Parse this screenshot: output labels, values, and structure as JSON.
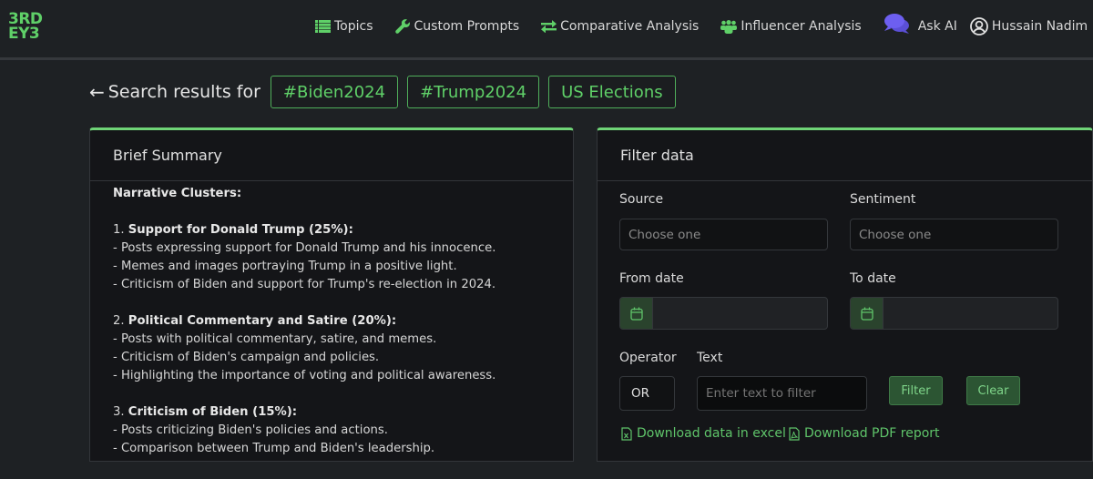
{
  "brand": {
    "logo_line1": "3RD",
    "logo_line2": "EY3",
    "accent": "#5fd068"
  },
  "nav": {
    "items": [
      {
        "label": "Topics",
        "icon": "list-icon"
      },
      {
        "label": "Custom Prompts",
        "icon": "wrench-icon"
      },
      {
        "label": "Comparative Analysis",
        "icon": "exchange-arrows-icon"
      },
      {
        "label": "Influencer Analysis",
        "icon": "users-group-icon"
      },
      {
        "label": "Ask AI",
        "icon": "chat-bubbles-icon"
      }
    ],
    "user": {
      "name": "Hussain Nadim",
      "icon": "user-circle-icon"
    }
  },
  "search": {
    "label": "Search results for",
    "tags": [
      "#Biden2024",
      "#Trump2024",
      "US Elections"
    ]
  },
  "summary": {
    "title": "Brief Summary",
    "heading": "Narrative Clusters:",
    "clusters": [
      {
        "number": "1.",
        "title": "Support for Donald Trump (25%):",
        "points": [
          "- Posts expressing support for Donald Trump and his innocence.",
          "- Memes and images portraying Trump in a positive light.",
          "- Criticism of Biden and support for Trump's re-election in 2024."
        ]
      },
      {
        "number": "2.",
        "title": "Political Commentary and Satire (20%):",
        "points": [
          "- Posts with political commentary, satire, and memes.",
          "- Criticism of Biden's campaign and policies.",
          "- Highlighting the importance of voting and political awareness."
        ]
      },
      {
        "number": "3.",
        "title": "Criticism of Biden (15%):",
        "points": [
          "- Posts criticizing Biden's policies and actions.",
          "- Comparison between Trump and Biden's leadership."
        ]
      }
    ]
  },
  "filter": {
    "title": "Filter data",
    "source": {
      "label": "Source",
      "placeholder": "Choose one"
    },
    "sentiment": {
      "label": "Sentiment",
      "placeholder": "Choose one"
    },
    "from_date": {
      "label": "From date",
      "value": ""
    },
    "to_date": {
      "label": "To date",
      "value": ""
    },
    "operator": {
      "label": "Operator",
      "value": "OR"
    },
    "text": {
      "label": "Text",
      "placeholder": "Enter text to filter"
    },
    "filter_button": "Filter",
    "clear_button": "Clear",
    "download_excel": "Download data in excel",
    "download_pdf": "Download PDF report"
  }
}
